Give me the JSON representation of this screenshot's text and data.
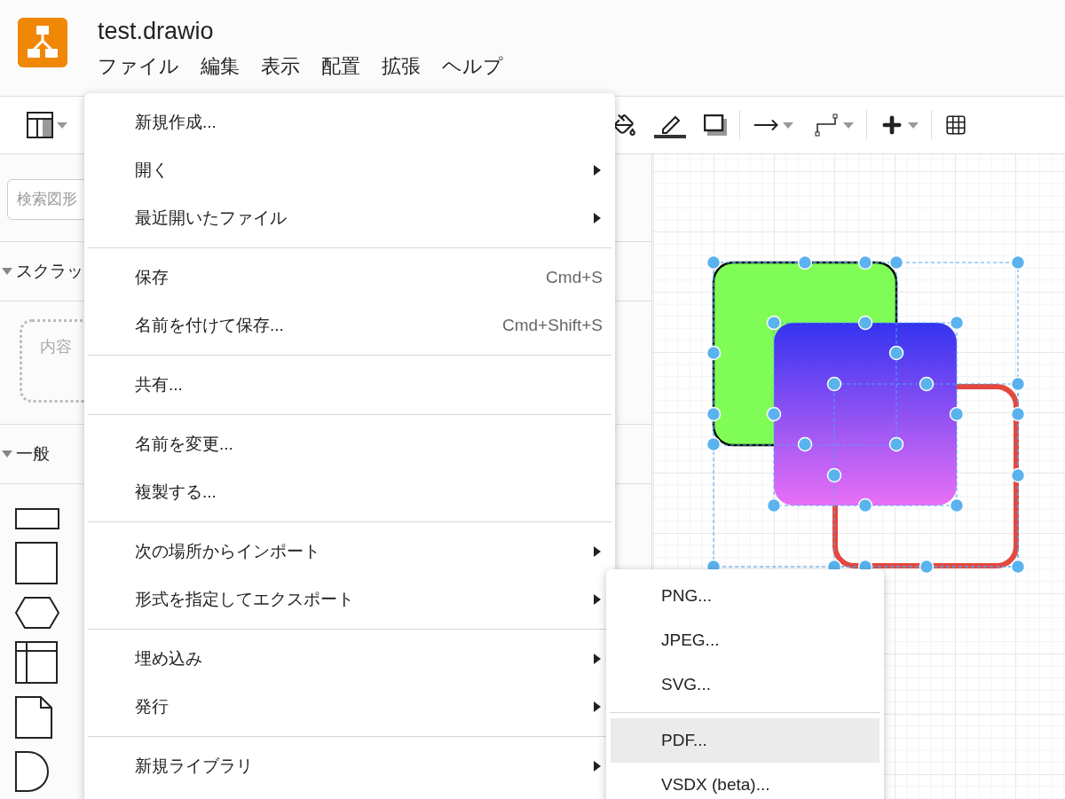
{
  "app": {
    "file_name": "test.drawio"
  },
  "menubar": [
    {
      "label": "ファイル"
    },
    {
      "label": "編集"
    },
    {
      "label": "表示"
    },
    {
      "label": "配置"
    },
    {
      "label": "拡張"
    },
    {
      "label": "ヘルプ"
    }
  ],
  "sidebar": {
    "search": {
      "placeholder": "検索図形"
    },
    "sections": [
      {
        "title": "スクラッ",
        "expanded": true,
        "kind": "scratchpad",
        "hint": "内容"
      },
      {
        "title": "一般",
        "expanded": true,
        "kind": "shapes"
      }
    ]
  },
  "file_menu": {
    "sections": [
      [
        {
          "label": "新規作成...",
          "submenu": false
        },
        {
          "label": "開く",
          "submenu": true
        },
        {
          "label": "最近開いたファイル",
          "submenu": true
        }
      ],
      [
        {
          "label": "保存",
          "shortcut": "Cmd+S",
          "submenu": false
        },
        {
          "label": "名前を付けて保存...",
          "shortcut": "Cmd+Shift+S",
          "submenu": false
        }
      ],
      [
        {
          "label": "共有...",
          "submenu": false
        }
      ],
      [
        {
          "label": "名前を変更...",
          "submenu": false
        },
        {
          "label": "複製する...",
          "submenu": false
        }
      ],
      [
        {
          "label": "次の場所からインポート",
          "submenu": true
        },
        {
          "label": "形式を指定してエクスポート",
          "submenu": true
        }
      ],
      [
        {
          "label": "埋め込み",
          "submenu": true
        },
        {
          "label": "発行",
          "submenu": true
        }
      ],
      [
        {
          "label": "新規ライブラリ",
          "submenu": true
        }
      ]
    ]
  },
  "export_submenu": {
    "sections": [
      [
        {
          "label": "PNG...",
          "selected": false
        },
        {
          "label": "JPEG...",
          "selected": false
        },
        {
          "label": "SVG...",
          "selected": false
        }
      ],
      [
        {
          "label": "PDF...",
          "selected": true
        },
        {
          "label": "VSDX (beta)...",
          "selected": false
        }
      ]
    ]
  }
}
